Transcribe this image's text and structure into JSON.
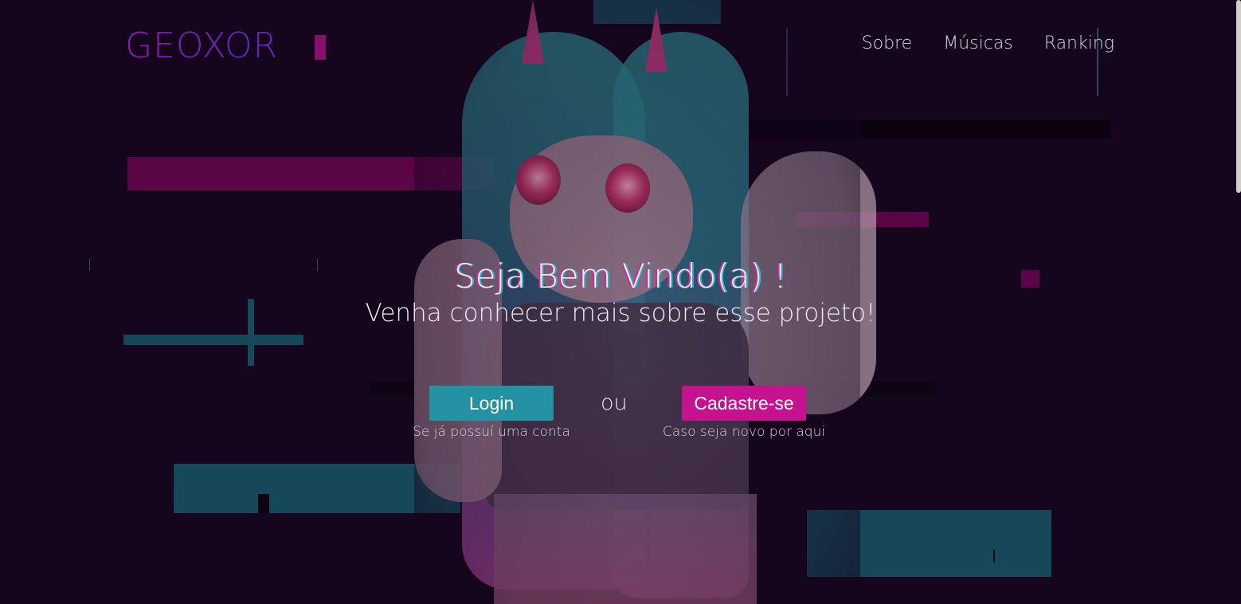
{
  "brand": {
    "logo": "GEOXOR"
  },
  "nav": {
    "items": [
      {
        "label": "Sobre"
      },
      {
        "label": "Músicas"
      },
      {
        "label": "Ranking"
      }
    ]
  },
  "hero": {
    "title": "Seja Bem Vindo(a) !",
    "subtitle": "Venha conhecer mais sobre esse projeto!"
  },
  "actions": {
    "login": {
      "label": "Login",
      "hint": "Se já possuí uma conta"
    },
    "separator": "ou",
    "signup": {
      "label": "Cadastre-se",
      "hint": "Caso seja novo por aqui"
    }
  },
  "colors": {
    "background": "#15051d",
    "login_button": "#2592a3",
    "signup_button": "#c5128f",
    "logo": "#6f1fb0"
  }
}
